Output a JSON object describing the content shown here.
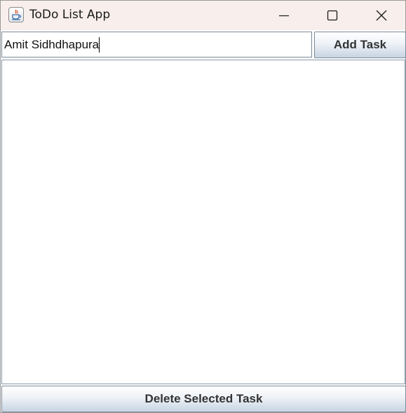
{
  "window": {
    "title": "ToDo List App"
  },
  "icons": {
    "app": "java-coffee-cup-icon",
    "minimize": "minimize-icon",
    "maximize": "maximize-icon",
    "close": "close-icon"
  },
  "input": {
    "value": "Amit Sidhdhapura"
  },
  "buttons": {
    "add_label": "Add Task",
    "delete_label": "Delete Selected Task"
  },
  "task_list": {
    "items": []
  }
}
